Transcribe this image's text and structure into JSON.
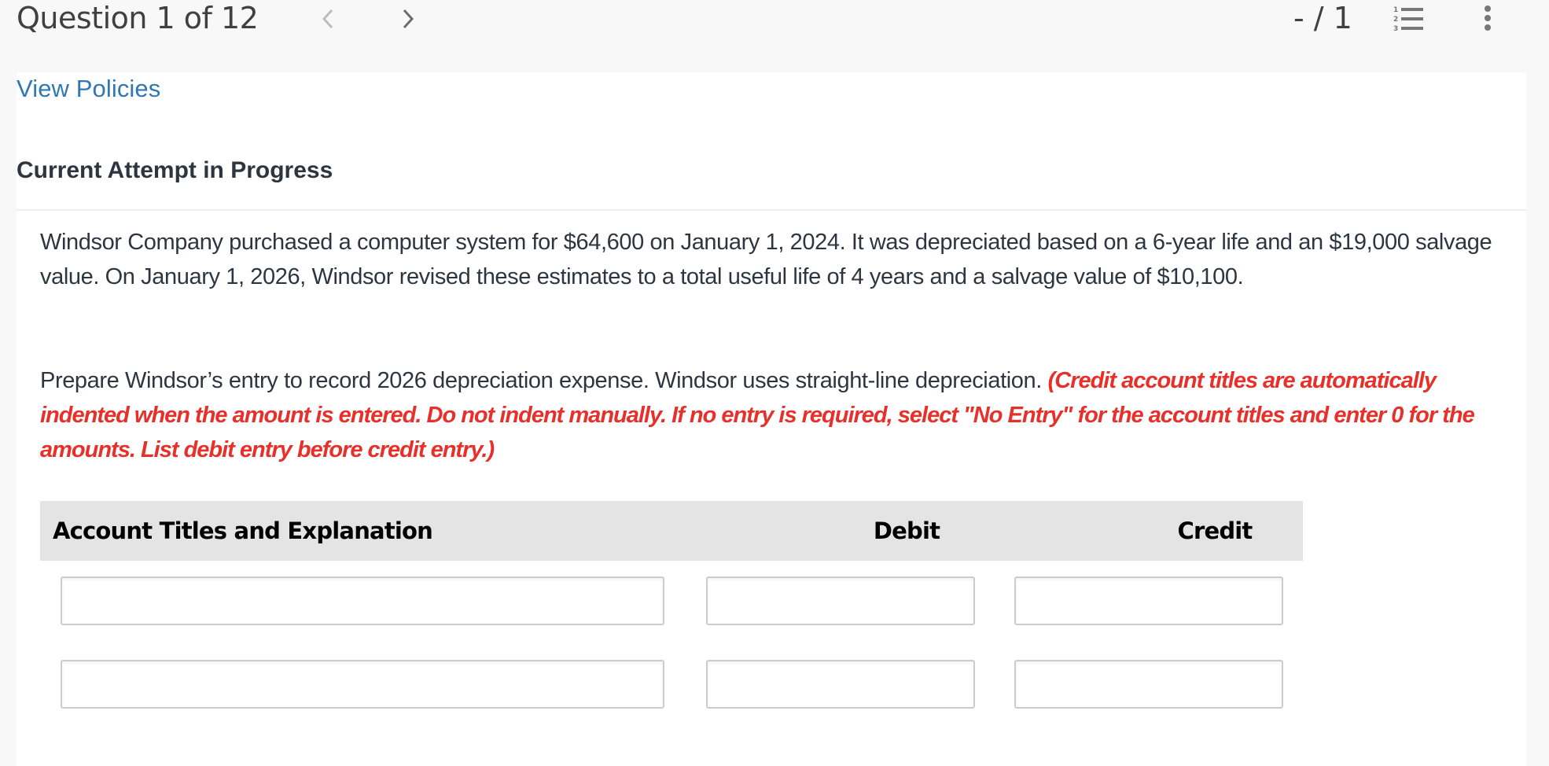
{
  "header": {
    "question_counter": "Question 1 of 12",
    "prev_icon": "chevron-left-icon",
    "next_icon": "chevron-right-icon",
    "score": "- / 1",
    "question_list_icon": "numbered-list-icon",
    "more_icon": "vertical-ellipsis-icon"
  },
  "links": {
    "view_policies": "View Policies"
  },
  "attempt_status": "Current Attempt in Progress",
  "question": {
    "text": "Windsor Company purchased a computer system for $64,600 on January 1, 2024. It was depreciated based on a 6-year life and an $19,000 salvage value. On January 1, 2026, Windsor revised these estimates to a total useful life of 4 years and a salvage value of $10,100.",
    "instruction": "Prepare Windsor’s entry to record 2026 depreciation expense. Windsor uses straight-line depreciation.",
    "note": "(Credit account titles are automatically indented when the amount is entered. Do not indent manually. If no entry is required, select \"No Entry\" for the account titles and enter 0 for the amounts. List debit entry before credit entry.)"
  },
  "journal_table": {
    "columns": {
      "account": "Account Titles and Explanation",
      "debit": "Debit",
      "credit": "Credit"
    },
    "rows": [
      {
        "account": "",
        "debit": "",
        "credit": ""
      },
      {
        "account": "",
        "debit": "",
        "credit": ""
      }
    ]
  },
  "colors": {
    "link": "#2f78b4",
    "note_red": "#e8302b",
    "text_dark": "#2d3640",
    "header_bg": "#e4e4e4"
  }
}
